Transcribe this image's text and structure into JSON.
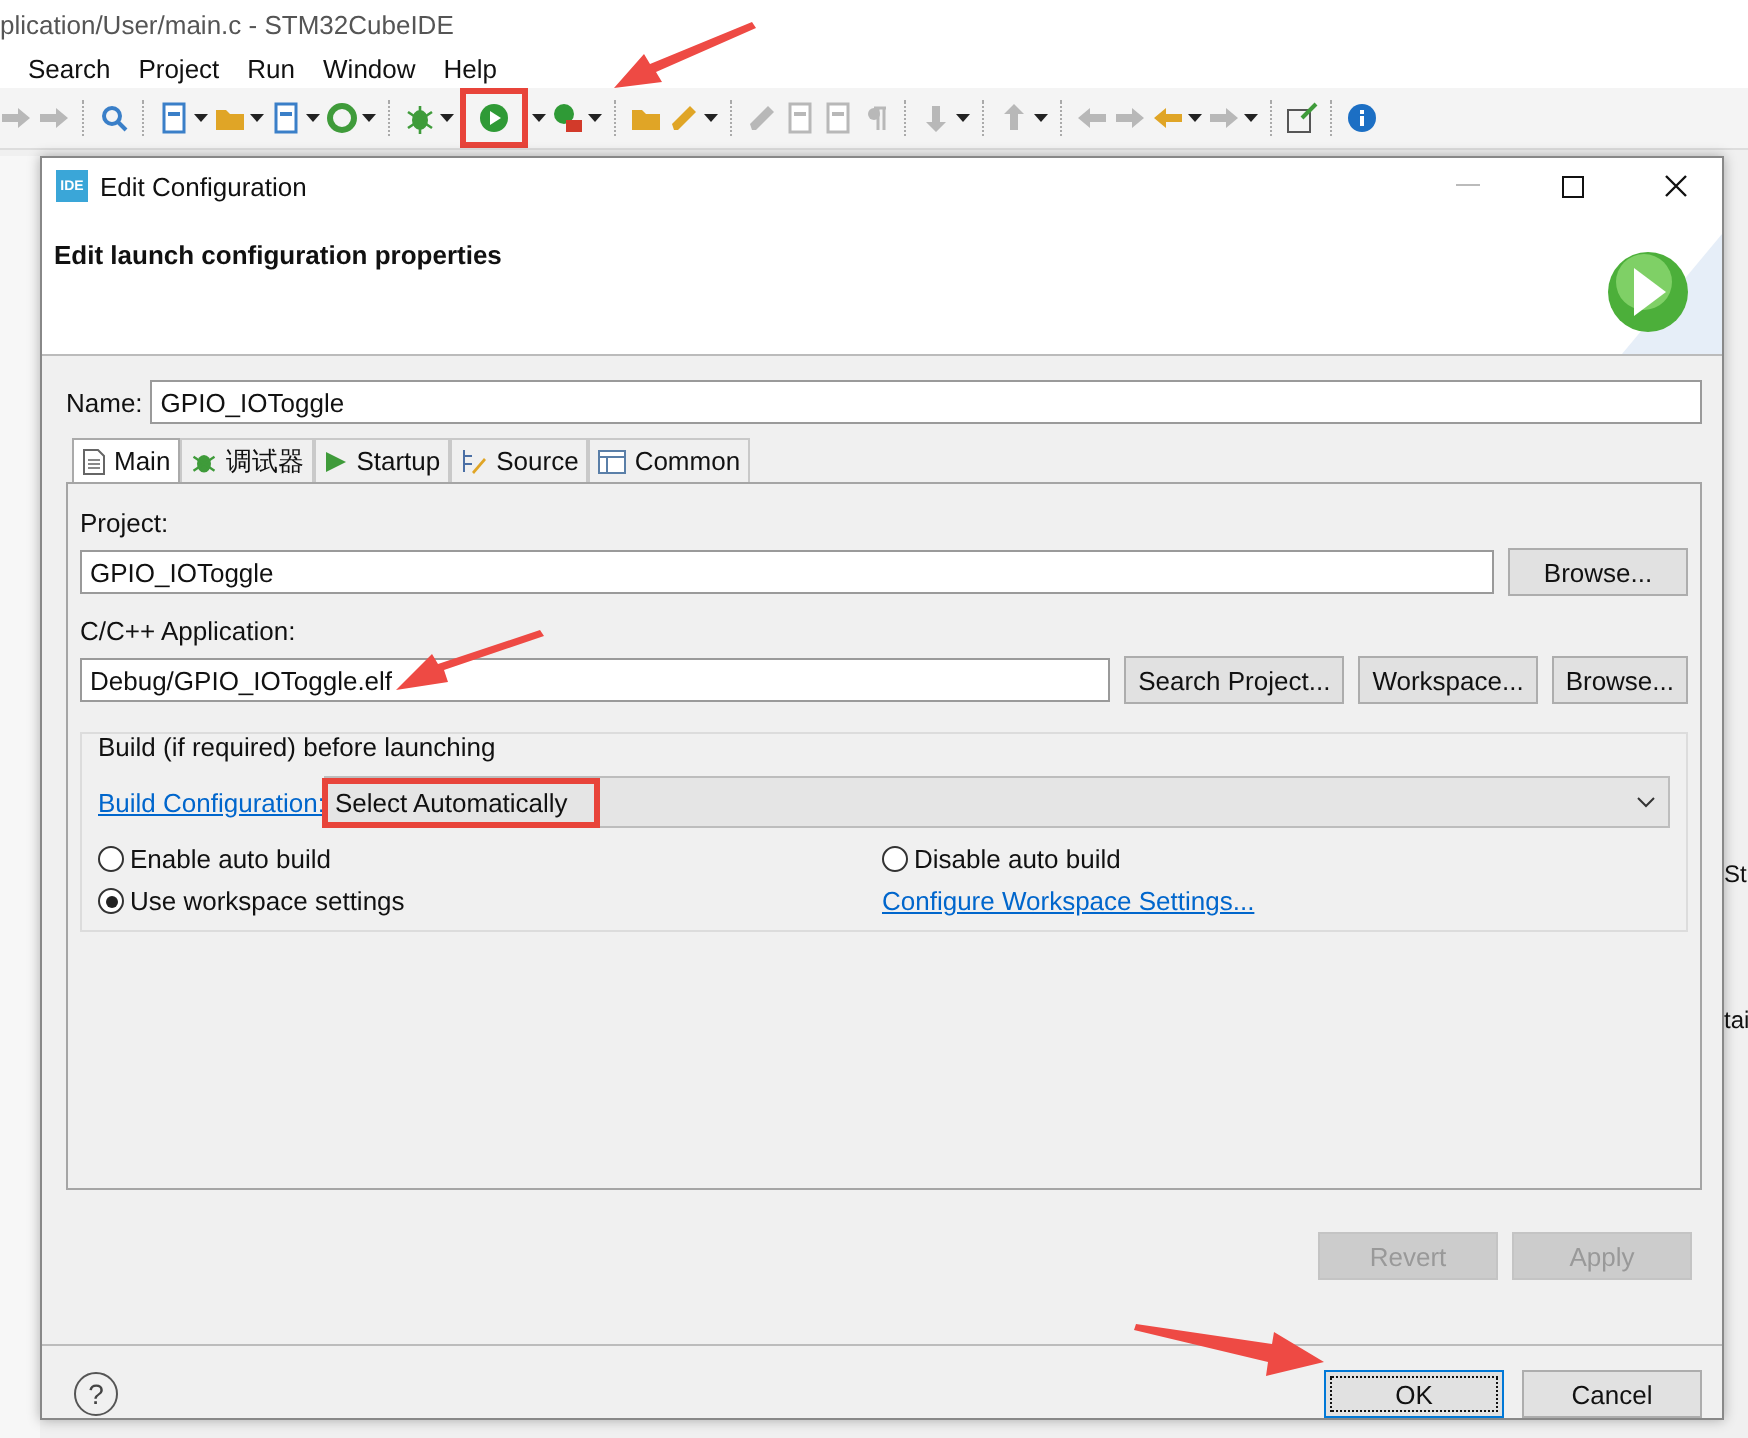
{
  "ide": {
    "title": "plication/User/main.c - STM32CubeIDE",
    "menu": [
      "Search",
      "Project",
      "Run",
      "Window",
      "Help"
    ],
    "side_texts": [
      "St",
      "tai"
    ]
  },
  "dialog": {
    "app_icon_text": "IDE",
    "title": "Edit Configuration",
    "header": "Edit launch configuration properties",
    "name_label": "Name:",
    "name_value": "GPIO_IOToggle",
    "tabs": [
      {
        "label": "Main",
        "kind": "main",
        "selected": true
      },
      {
        "label": "调试器",
        "kind": "debugger",
        "selected": false
      },
      {
        "label": "Startup",
        "kind": "startup",
        "selected": false
      },
      {
        "label": "Source",
        "kind": "source",
        "selected": false
      },
      {
        "label": "Common",
        "kind": "common",
        "selected": false
      }
    ],
    "project_label": "Project:",
    "project_value": "GPIO_IOToggle",
    "project_button": "Browse...",
    "app_label": "C/C++ Application:",
    "app_value": "Debug/GPIO_IOToggle.elf",
    "app_buttons": [
      "Search Project...",
      "Workspace...",
      "Browse..."
    ],
    "build": {
      "title": "Build (if required) before launching",
      "config_link": "Build Configuration:",
      "config_value": "Select Automatically",
      "radios": [
        {
          "label": "Enable auto build",
          "selected": false
        },
        {
          "label": "Disable auto build",
          "selected": false
        },
        {
          "label": "Use workspace settings",
          "selected": true
        }
      ],
      "settings_link": "Configure Workspace Settings..."
    },
    "buttons": [
      {
        "label": "Revert",
        "disabled": true,
        "focused": false
      },
      {
        "label": "Apply",
        "disabled": true,
        "focused": false
      }
    ],
    "help_button": "?",
    "footer_buttons": [
      {
        "label": "OK",
        "disabled": false,
        "focused": true
      },
      {
        "label": "Cancel",
        "disabled": false,
        "focused": false
      }
    ]
  }
}
